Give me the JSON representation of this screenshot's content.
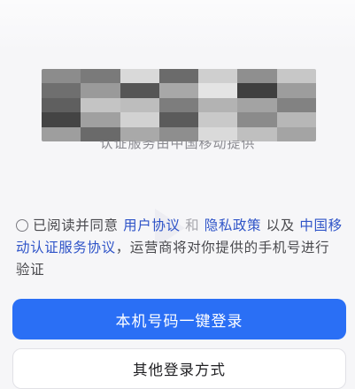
{
  "phone_number_block": {
    "caption": "认证服务由中国移动提供",
    "mosaic_colors": [
      "#8c8c8c",
      "#7a7a7a",
      "#d9d9d9",
      "#6b6b6b",
      "#cfcfcf",
      "#8f8f8f",
      "#c7c7c7",
      "#6f6f6f",
      "#9a9a9a",
      "#555555",
      "#a8a8a8",
      "#e4e4e4",
      "#3f3f3f",
      "#9d9d9d",
      "#5f5f5f",
      "#c4c4c4",
      "#bdbdbd",
      "#7d7d7d",
      "#b3b3b3",
      "#a3a3a3",
      "#828282",
      "#444444",
      "#a0a0a0",
      "#d2d2d2",
      "#5b5b5b",
      "#c9c9c9",
      "#8b8b8b",
      "#b7b7b7",
      "#9e9e9e",
      "#6a6a6a",
      "#a9a9a9",
      "#8e8e8e",
      "#dadada",
      "#bfbfbf",
      "#a4a4a4"
    ]
  },
  "agreement": {
    "prefix": "已阅读并同意",
    "user_agreement": "用户协议",
    "and": "和",
    "privacy_policy": "隐私政策",
    "and2": "以及",
    "carrier_agreement": "中国移动认证服务协议",
    "suffix": "，运营商将对你提供的手机号进行验证"
  },
  "buttons": {
    "one_click_login": "本机号码一键登录",
    "other_login": "其他登录方式"
  },
  "colors": {
    "primary": "#2a6ff5",
    "link": "#2f54c8"
  }
}
